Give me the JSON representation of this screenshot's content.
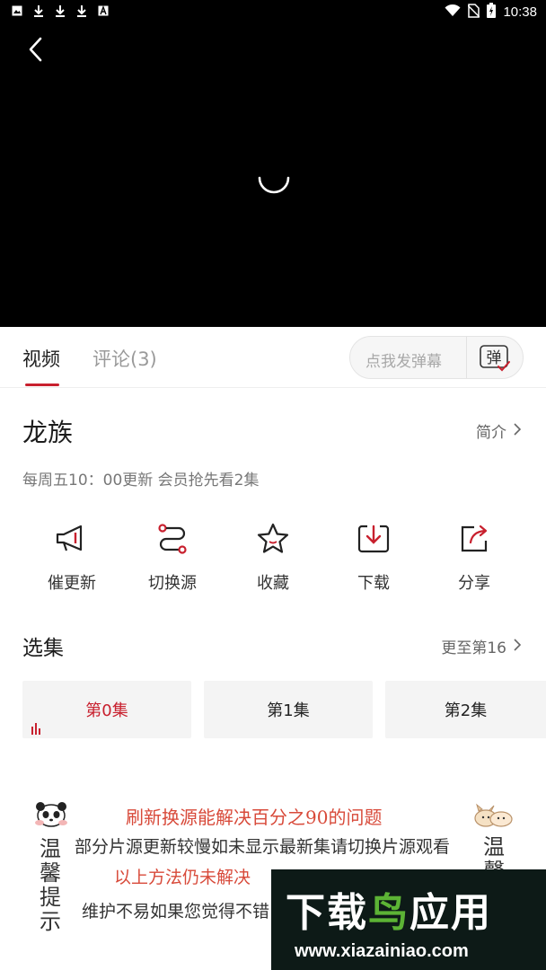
{
  "status_bar": {
    "time": "10:38",
    "left_icons": [
      "image-icon",
      "download-icon",
      "download-icon",
      "download-icon",
      "app-a-icon"
    ],
    "right_icons": [
      "wifi-icon",
      "no-sim-icon",
      "battery-charging-icon"
    ]
  },
  "player": {
    "back_icon": "chevron-left-icon",
    "loading_icon": "loading-spinner-icon"
  },
  "tabs": {
    "video": "视频",
    "comments": "评论(3)",
    "active_color": "#c8202e"
  },
  "danmu": {
    "placeholder": "点我发弹幕",
    "button_label": "弹"
  },
  "show": {
    "title": "龙族",
    "intro_link": "简介",
    "update_info": "每周五10：00更新 会员抢先看2集"
  },
  "actions": [
    {
      "label": "催更新",
      "icon": "megaphone-icon"
    },
    {
      "label": "切换源",
      "icon": "switch-source-icon"
    },
    {
      "label": "收藏",
      "icon": "star-icon"
    },
    {
      "label": "下载",
      "icon": "download-icon"
    },
    {
      "label": "分享",
      "icon": "share-icon"
    }
  ],
  "episodes": {
    "section_title": "选集",
    "more_link": "更至第16",
    "items": [
      {
        "label": "第0集",
        "active": true
      },
      {
        "label": "第1集",
        "active": false
      },
      {
        "label": "第2集",
        "active": false
      }
    ]
  },
  "notice": {
    "line1": "刷新换源能解决百分之90的问题",
    "line2": "部分片源更新较慢如未显示最新集请切换片源观看",
    "line3": "以上方法仍未解决",
    "line4": "维护不易如果您觉得不错",
    "left_vertical": "温馨提示",
    "right_vertical": "温馨"
  },
  "watermark": {
    "title_part1": "下载",
    "title_part2": "鸟",
    "title_part3": "应用",
    "url": "www.xiazainiao.com"
  }
}
